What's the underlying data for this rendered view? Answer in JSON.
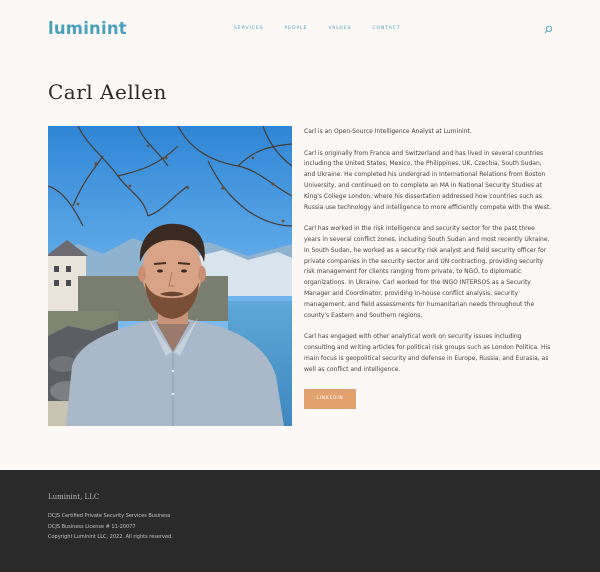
{
  "header": {
    "logo": "luminint",
    "nav": [
      "SERVICES",
      "PEOPLE",
      "VALUES",
      "CONTACT"
    ],
    "search_icon": "search-icon"
  },
  "profile": {
    "name": "Carl Aellen",
    "bio": [
      "Carl is an Open-Source Intelligence Analyst at Luminint.",
      "Carl is originally from France and Switzerland and has lived in several countries including the United States, Mexico, the Philippines, UK, Czechia, South Sudan, and Ukraine. He completed his undergrad in International Relations from Boston University, and continued on to complete an MA in National Security Studies at King's College London, where his dissertation addressed how countries such as Russia use technology and intelligence to more efficiently compete with the West.",
      "Carl has worked in the risk intelligence and security sector for the past three years in several conflict zones, including South Sudan and most recently Ukraine. In South Sudan, he worked as a security risk analyst and field security officer for private companies in the security sector and UN contracting, providing security risk management for clients ranging from private, to NGO, to diplomatic organizations. In Ukraine, Carl worked for the INGO INTERSOS as a Security Manager and Coordinator, providing in-house conflict analysis, security management, and field assessments for humanitarian needs throughout the county's Eastern and Southern regions.",
      "Carl has engaged with other analytical work on security issues including consulting and writing articles for political risk groups such as London Politica. His main focus is geopolitical security and defense in Europe, Russia, and Eurasia, as well as conflict and intelligence."
    ],
    "linkedin_label": "LINKEDIN"
  },
  "footer": {
    "brand": "Luminint, LLC",
    "lines": [
      "DCJS Certified Private Security Services Business",
      "DCJS Business License # 11-20077",
      "Copyright Luminint LLC, 2022.  All rights reserved."
    ]
  },
  "colors": {
    "accent": "#4aa0bd",
    "button": "#e2a270",
    "footer_bg": "#2a2a2a",
    "page_bg": "#fbf8f6"
  }
}
